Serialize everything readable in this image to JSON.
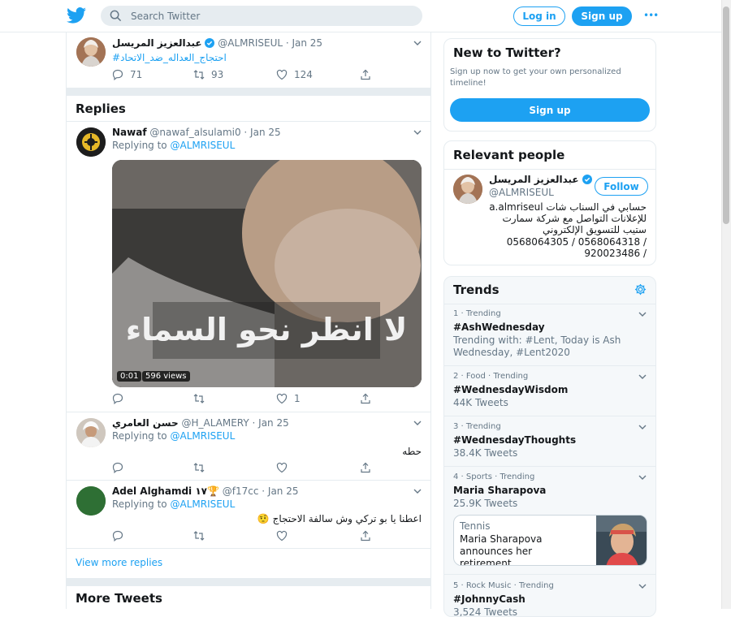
{
  "header": {
    "search_placeholder": "Search Twitter",
    "login_label": "Log in",
    "signup_label": "Sign up",
    "more_label": "•••"
  },
  "main_tweet": {
    "name": "عبدالعزيز المريسل",
    "handle": "@ALMRISEUL · Jan 25",
    "text": "#احتجاج_العداله_ضد_الاتحاد",
    "replies": "71",
    "retweets": "93",
    "likes": "124"
  },
  "replies_title": "Replies",
  "replies": [
    {
      "name": "Nawaf",
      "handle": "@nawaf_alsulami0 · Jan 25",
      "replying_prefix": "Replying to",
      "replying_to": "@ALMRISEUL",
      "video_caption": "لا انظر نحو السماء",
      "video_time": "0:01",
      "video_views": "596 views",
      "likes": "1"
    },
    {
      "name": "حسن العامري",
      "handle": "@H_ALAMERY · Jan 25",
      "replying_prefix": "Replying to",
      "replying_to": "@ALMRISEUL",
      "text": "حطه"
    },
    {
      "name": "Adel Alghamdi ١٧🏆",
      "handle": "@f17cc · Jan 25",
      "replying_prefix": "Replying to",
      "replying_to": "@ALMRISEUL",
      "text": "اعطنا يا بو تركي وش سالفة الاحتجاج 🤨"
    }
  ],
  "view_more_replies": "View more replies",
  "more_tweets_title": "More Tweets",
  "new_to_twitter": {
    "title": "New to Twitter?",
    "subtitle": "Sign up now to get your own personalized timeline!",
    "button": "Sign up"
  },
  "relevant_people": {
    "title": "Relevant people",
    "name": "عبدالعزيز المريسل",
    "handle": "@ALMRISEUL",
    "follow_label": "Follow",
    "bio_line1": "حسابي في السناب شات a.almriseul",
    "bio_line2": "للإعلانات التواصل مع شركة سمارت",
    "bio_line3": "ستيب للتسويق الإلكتروني",
    "bio_line4": "0568064305 / 0568064318 /",
    "bio_line5": "920023486 /"
  },
  "trends": {
    "title": "Trends",
    "items": [
      {
        "meta": "1 · Trending",
        "name": "#AshWednesday",
        "count": "Trending with: #Lent, Today is Ash Wednesday, #Lent2020"
      },
      {
        "meta": "2 · Food · Trending",
        "name": "#WednesdayWisdom",
        "count": "44K Tweets"
      },
      {
        "meta": "3 · Trending",
        "name": "#WednesdayThoughts",
        "count": "38.4K Tweets"
      },
      {
        "meta": "4 · Sports · Trending",
        "name": "Maria Sharapova",
        "count": "25.9K Tweets",
        "card_category": "Tennis",
        "card_text": "Maria Sharapova announces her retirement..."
      },
      {
        "meta": "5 · Rock Music · Trending",
        "name": "#JohnnyCash",
        "count": "3,524 Tweets"
      }
    ]
  },
  "colors": {
    "accent": "#1da1f2",
    "muted": "#657786",
    "border": "#e6ecf0"
  }
}
